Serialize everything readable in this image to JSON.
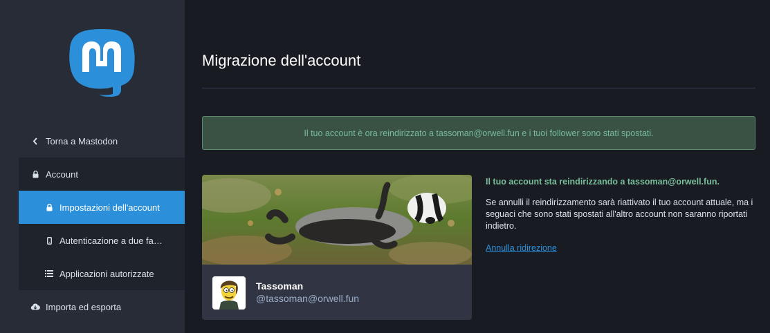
{
  "sidebar": {
    "back_label": "Torna a Mastodon",
    "account_label": "Account",
    "sub_items": [
      {
        "label": "Impostazioni dell'account",
        "icon": "lock-icon",
        "active": true
      },
      {
        "label": "Autenticazione a due fa…",
        "icon": "mobile-icon",
        "active": false
      },
      {
        "label": "Applicazioni autorizzate",
        "icon": "list-icon",
        "active": false
      }
    ],
    "import_label": "Importa ed esporta"
  },
  "page": {
    "title": "Migrazione dell'account",
    "notice": "Il tuo account è ora reindirizzato a tassoman@orwell.fun e i tuoi follower sono stati spostati."
  },
  "card": {
    "display_name": "Tassoman",
    "acct": "@tassoman@orwell.fun"
  },
  "info": {
    "heading": "Il tuo account sta reindirizzando a tassoman@orwell.fun.",
    "body": "Se annulli il reindirizzamento sarà riattivato il tuo account attuale, ma i seguaci che sono stati spostati all'altro account non saranno riportati indietro.",
    "link": "Annulla ridirezione"
  },
  "colors": {
    "accent": "#2b90d9",
    "success": "#79bd9a",
    "sidebar": "#282c37",
    "background": "#191b22"
  }
}
